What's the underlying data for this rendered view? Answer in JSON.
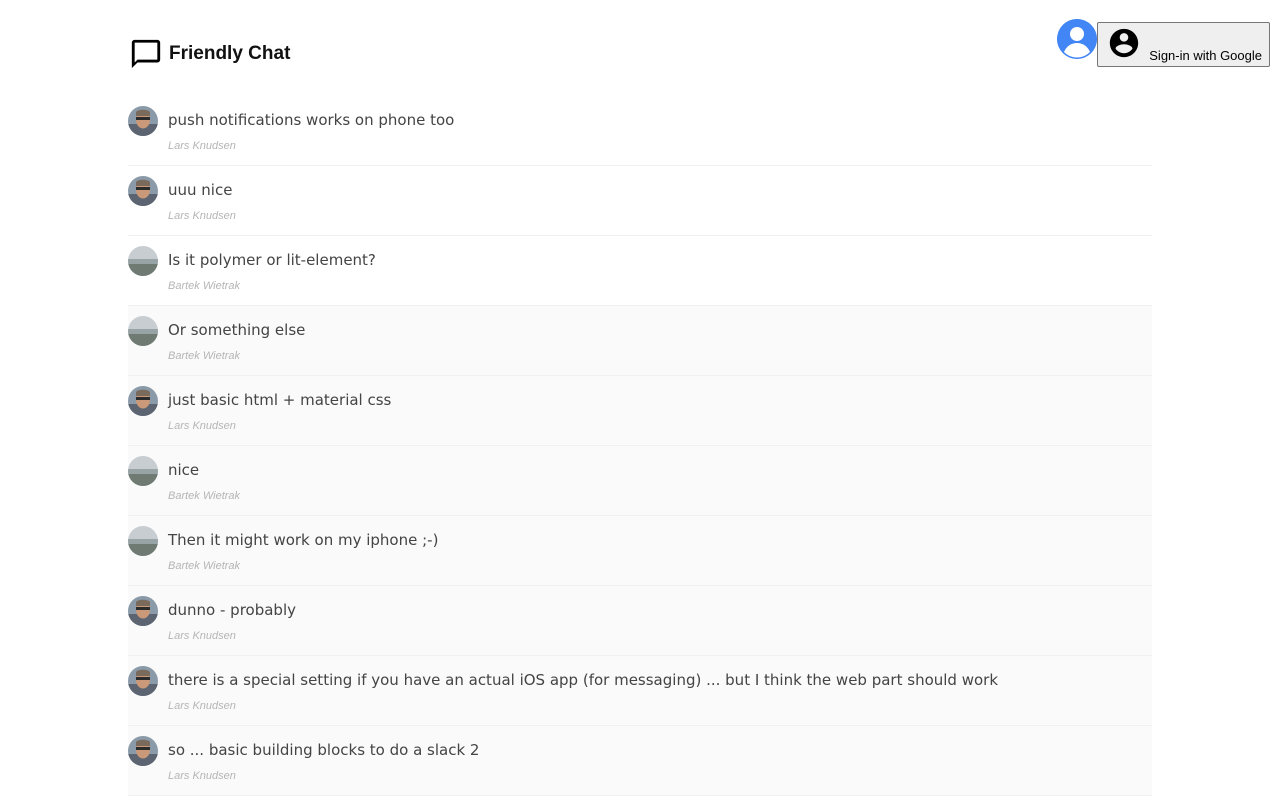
{
  "header": {
    "title": "Friendly Chat",
    "chat_icon": "chat-bubble-icon",
    "user_icon": "account-circle-icon",
    "signin_label": "Sign-in with Google"
  },
  "colors": {
    "accent": "#4285f4",
    "message_text": "#444444",
    "author_text": "#b5b5b5"
  },
  "messages": [
    {
      "text": "push notifications works on phone too",
      "author": "Lars Knudsen",
      "avatar": "lars"
    },
    {
      "text": "uuu nice",
      "author": "Lars Knudsen",
      "avatar": "lars"
    },
    {
      "text": "Is it polymer or lit-element?",
      "author": "Bartek Wietrak",
      "avatar": "bartek"
    },
    {
      "text": "Or something else",
      "author": "Bartek Wietrak",
      "avatar": "bartek"
    },
    {
      "text": "just basic html + material css",
      "author": "Lars Knudsen",
      "avatar": "lars"
    },
    {
      "text": "nice",
      "author": "Bartek Wietrak",
      "avatar": "bartek"
    },
    {
      "text": "Then it might work on my iphone ;-)",
      "author": "Bartek Wietrak",
      "avatar": "bartek"
    },
    {
      "text": "dunno - probably",
      "author": "Lars Knudsen",
      "avatar": "lars"
    },
    {
      "text": "there is a special setting if you have an actual iOS app (for messaging) ... but I think the web part should work",
      "author": "Lars Knudsen",
      "avatar": "lars"
    },
    {
      "text": "so ... basic building blocks to do a slack 2",
      "author": "Lars Knudsen",
      "avatar": "lars"
    }
  ]
}
